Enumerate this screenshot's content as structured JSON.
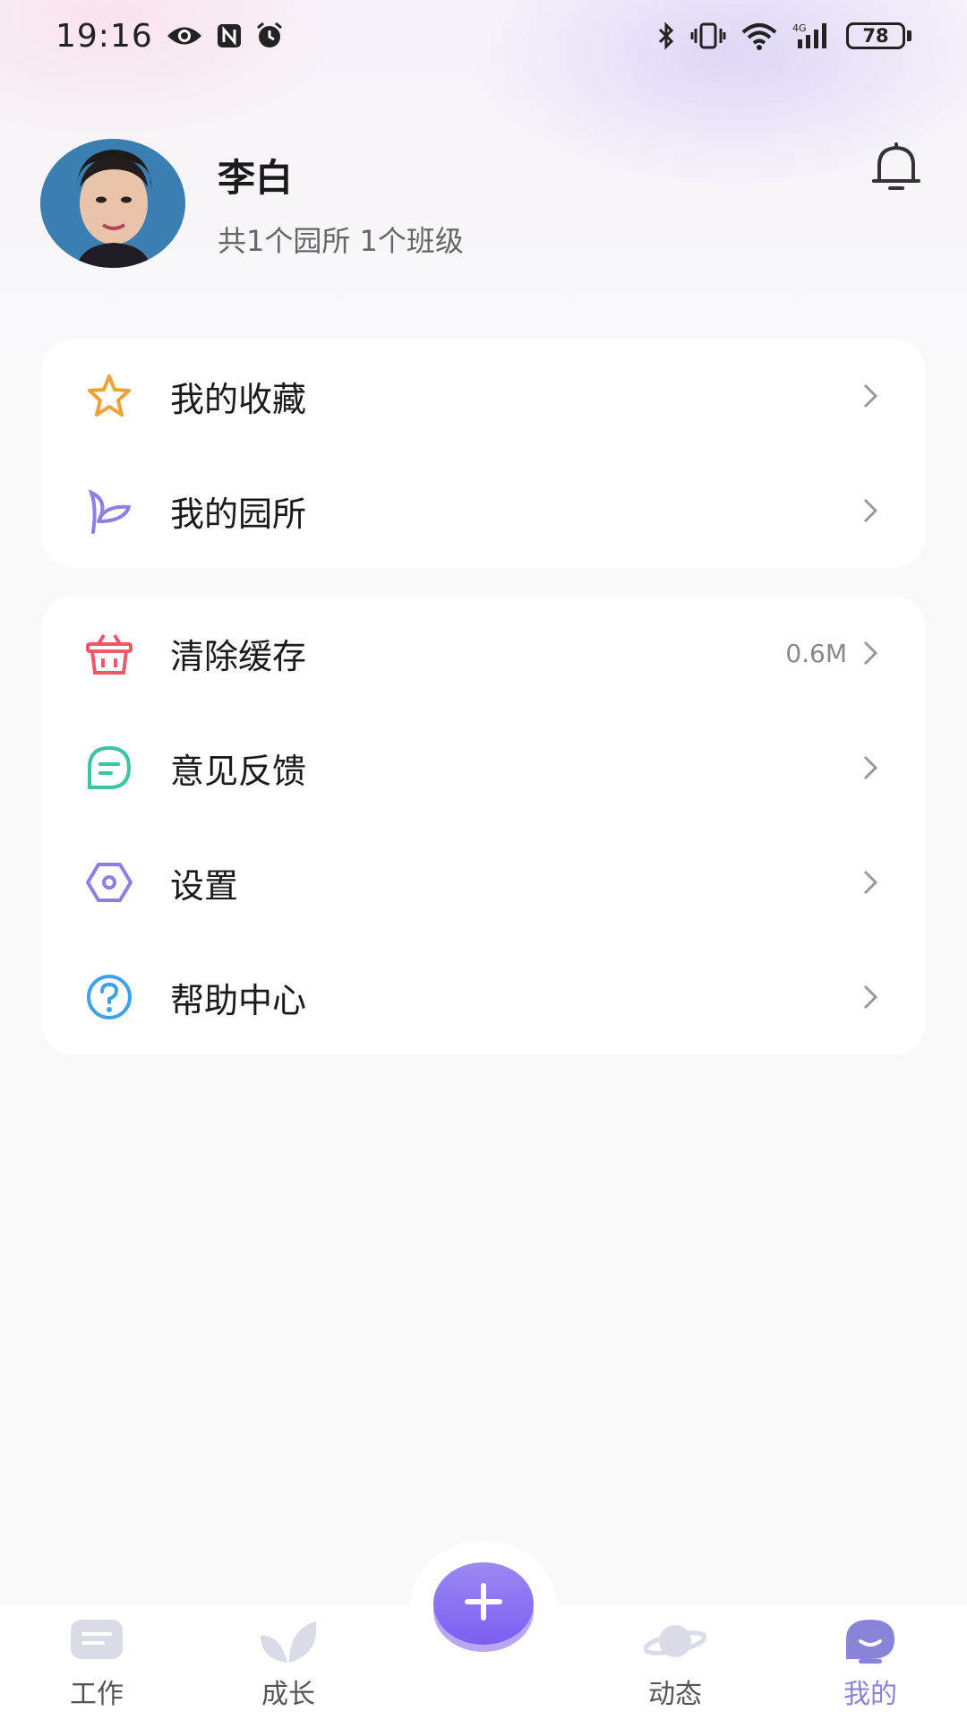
{
  "status_bar": {
    "time": "19:16",
    "battery": "78"
  },
  "profile": {
    "name": "李白",
    "subtitle": "共1个园所 1个班级"
  },
  "menu_group_1": [
    {
      "label": "我的收藏",
      "icon": "star-icon"
    },
    {
      "label": "我的园所",
      "icon": "sprout-icon"
    }
  ],
  "menu_group_2": [
    {
      "label": "清除缓存",
      "icon": "basket-icon",
      "value": "0.6M"
    },
    {
      "label": "意见反馈",
      "icon": "message-icon"
    },
    {
      "label": "设置",
      "icon": "settings-icon"
    },
    {
      "label": "帮助中心",
      "icon": "help-icon"
    }
  ],
  "bottom_nav": {
    "items": [
      {
        "label": "工作",
        "icon": "work-icon",
        "active": false
      },
      {
        "label": "成长",
        "icon": "leaf-icon",
        "active": false
      },
      {
        "label": "动态",
        "icon": "planet-icon",
        "active": false
      },
      {
        "label": "我的",
        "icon": "me-icon",
        "active": true
      }
    ],
    "fab_icon": "plus-icon"
  },
  "colors": {
    "accent": "#8a84d8",
    "fab": "#7b5df0",
    "star": "#f0a23a",
    "sprout": "#8b80e6",
    "basket": "#ec5a6a",
    "message": "#3ec3a6",
    "settings": "#8b80e6",
    "help": "#3fa2e8"
  }
}
